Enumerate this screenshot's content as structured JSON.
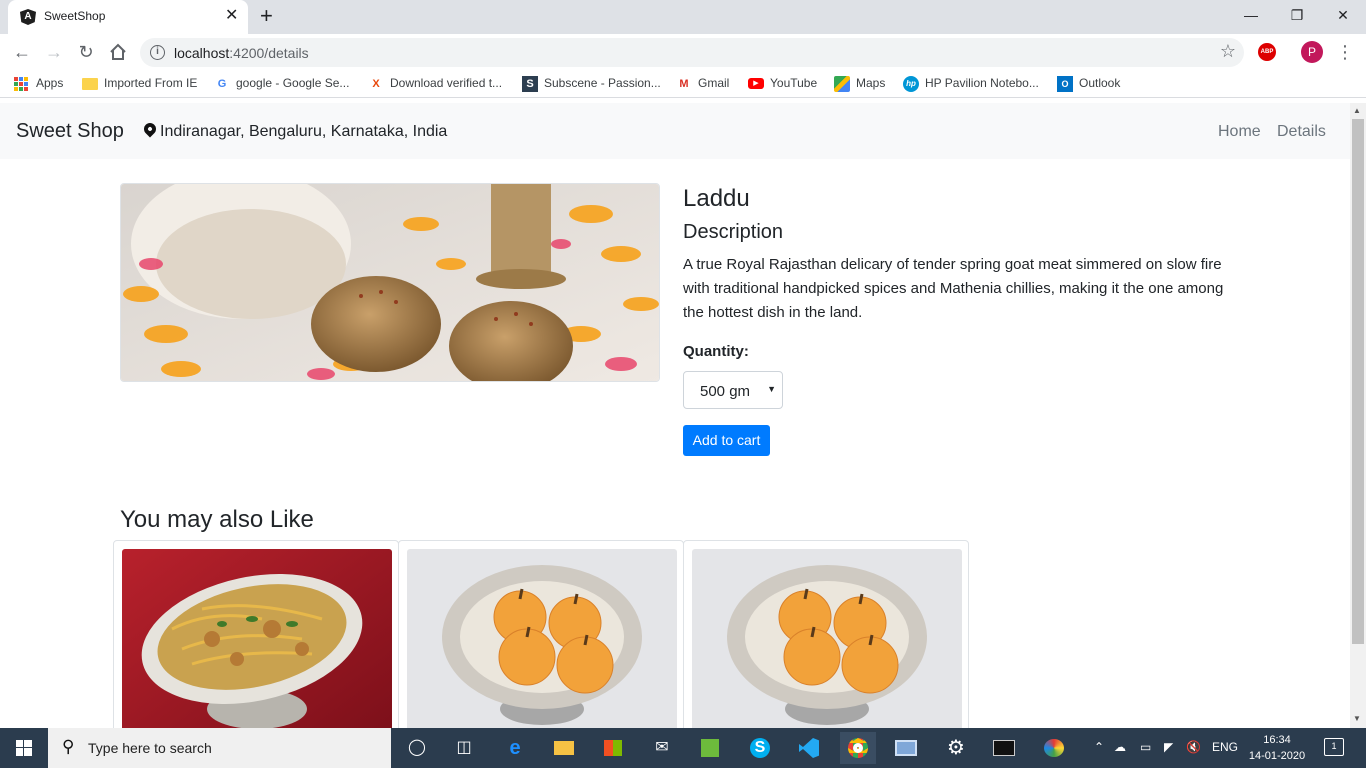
{
  "browser": {
    "tab_title": "SweetShop",
    "tab_close": "✕",
    "new_tab": "+",
    "url_host": "localhost",
    "url_rest": ":4200/details",
    "abp": "ABP",
    "profile_initial": "P",
    "window_controls": {
      "minimize": "—",
      "restore": "❐",
      "close": "✕"
    }
  },
  "bookmarks": [
    {
      "label": "Apps",
      "icon": "apps-grid-icon"
    },
    {
      "label": "Imported From IE",
      "icon": "folder-icon"
    },
    {
      "label": "google - Google Se...",
      "icon": "google-icon"
    },
    {
      "label": "Download verified t...",
      "icon": "x-icon"
    },
    {
      "label": "Subscene - Passion...",
      "icon": "subscene-icon"
    },
    {
      "label": "Gmail",
      "icon": "gmail-icon"
    },
    {
      "label": "YouTube",
      "icon": "youtube-icon"
    },
    {
      "label": "Maps",
      "icon": "maps-icon"
    },
    {
      "label": "HP Pavilion Notebo...",
      "icon": "hp-icon"
    },
    {
      "label": "Outlook",
      "icon": "outlook-icon"
    }
  ],
  "navbar": {
    "brand": "Sweet Shop",
    "location": "Indiranagar, Bengaluru, Karnataka, India",
    "links": [
      "Home",
      "Details"
    ]
  },
  "product": {
    "name": "Laddu",
    "description_heading": "Description",
    "description": "A true Royal Rajasthan delicary of tender spring goat meat simmered on slow fire with traditional handpicked spices and Mathenia chillies, making it the one among the hottest dish in the land.",
    "quantity_label": "Quantity:",
    "quantity_value": "500 gm",
    "add_to_cart": "Add to cart"
  },
  "recommendations": {
    "heading": "You may also Like",
    "items": [
      {
        "image": "mixture-snack-bowl"
      },
      {
        "image": "apple-peda-bowl"
      },
      {
        "image": "apple-peda-bowl"
      }
    ]
  },
  "taskbar": {
    "search_placeholder": "Type here to search",
    "language": "ENG",
    "time": "16:34",
    "date": "14-01-2020",
    "notification_count": "1"
  }
}
